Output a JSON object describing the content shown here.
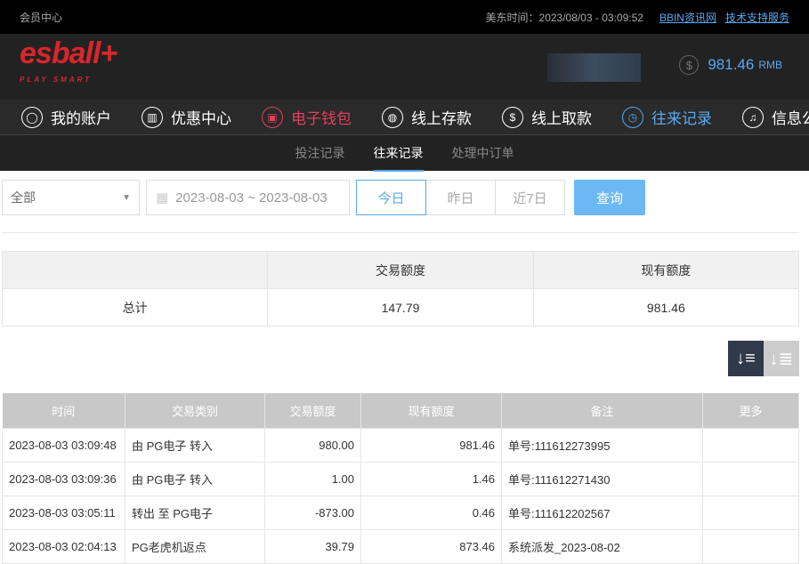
{
  "topbar": {
    "title": "会员中心",
    "time_label": "美东时间：2023/08/03 - 03:09:52",
    "links": [
      "BBIN资讯网",
      "技术支持服务"
    ]
  },
  "header": {
    "logo": "esball+",
    "logo_sub": "PLAY SMART",
    "balance": "981.46",
    "currency": "RMB"
  },
  "nav": [
    {
      "label": "我的账户",
      "icon": "user-icon"
    },
    {
      "label": "优惠中心",
      "icon": "gift-icon"
    },
    {
      "label": "电子钱包",
      "icon": "wallet-icon"
    },
    {
      "label": "线上存款",
      "icon": "deposit-icon"
    },
    {
      "label": "线上取款",
      "icon": "withdraw-icon"
    },
    {
      "label": "往来记录",
      "icon": "records-icon"
    },
    {
      "label": "信息公告",
      "icon": "bell-icon"
    }
  ],
  "subtabs": [
    "投注记录",
    "往来记录",
    "处理中订单"
  ],
  "filters": {
    "type": "全部",
    "date_range": "2023-08-03 ~ 2023-08-03",
    "quick": [
      "今日",
      "昨日",
      "近7日"
    ],
    "search": "查询"
  },
  "summary": {
    "headers": [
      "交易额度",
      "现有额度"
    ],
    "label": "总计",
    "amount": "147.79",
    "balance": "981.46"
  },
  "table": {
    "headers": [
      "时间",
      "交易类别",
      "交易额度",
      "现有额度",
      "备注",
      "更多"
    ],
    "rows": [
      [
        "2023-08-03 03:09:48",
        "由 PG电子 转入",
        "980.00",
        "981.46",
        "单号:111612273995",
        ""
      ],
      [
        "2023-08-03 03:09:36",
        "由 PG电子 转入",
        "1.00",
        "1.46",
        "单号:111612271430",
        ""
      ],
      [
        "2023-08-03 03:05:11",
        "转出 至 PG电子",
        "-873.00",
        "0.46",
        "单号:111612202567",
        ""
      ],
      [
        "2023-08-03 02:04:13",
        "PG老虎机返点",
        "39.79",
        "873.46",
        "系统派发_2023-08-02",
        ""
      ]
    ]
  }
}
